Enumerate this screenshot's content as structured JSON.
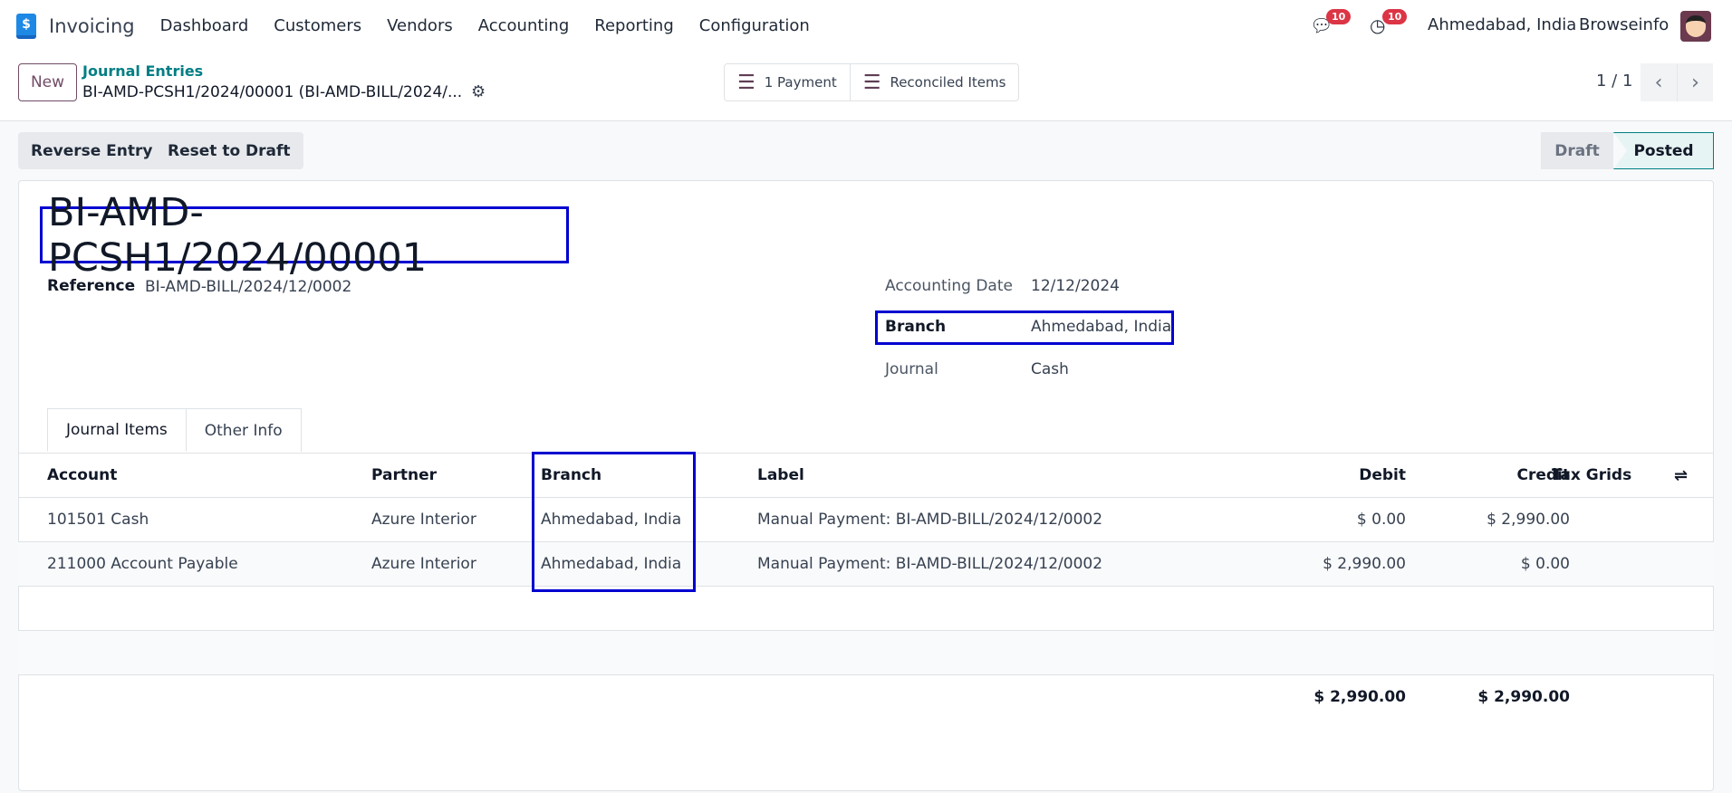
{
  "navbar": {
    "app_name": "Invoicing",
    "logo_glyph": "$",
    "menu": [
      "Dashboard",
      "Customers",
      "Vendors",
      "Accounting",
      "Reporting",
      "Configuration"
    ],
    "messages_count": "10",
    "activities_count": "10",
    "company": "Ahmedabad, India",
    "user": "Browseinfo"
  },
  "control_panel": {
    "new_label": "New",
    "breadcrumb_parent": "Journal Entries",
    "breadcrumb_current": "BI-AMD-PCSH1/2024/00001 (BI-AMD-BILL/2024/...",
    "smart_buttons": [
      "1 Payment",
      "Reconciled Items"
    ],
    "pager": "1 / 1"
  },
  "actions": {
    "reverse": "Reverse Entry",
    "reset": "Reset to Draft"
  },
  "statusbar": {
    "states": [
      "Draft",
      "Posted"
    ],
    "current": "Posted"
  },
  "form": {
    "title": "BI-AMD-PCSH1/2024/00001",
    "reference_label": "Reference",
    "reference": "BI-AMD-BILL/2024/12/0002",
    "date_label": "Accounting Date",
    "date": "12/12/2024",
    "branch_label": "Branch",
    "branch": "Ahmedabad, India",
    "journal_label": "Journal",
    "journal": "Cash"
  },
  "tabs": [
    "Journal Items",
    "Other Info"
  ],
  "table": {
    "headers": [
      "Account",
      "Partner",
      "Branch",
      "Label",
      "Debit",
      "Credit",
      "Tax Grids"
    ],
    "rows": [
      [
        "101501 Cash",
        "Azure Interior",
        "Ahmedabad, India",
        "Manual Payment: BI-AMD-BILL/2024/12/0002",
        "$ 0.00",
        "$ 2,990.00",
        ""
      ],
      [
        "211000 Account Payable",
        "Azure Interior",
        "Ahmedabad, India",
        "Manual Payment: BI-AMD-BILL/2024/12/0002",
        "$ 2,990.00",
        "$ 0.00",
        ""
      ]
    ],
    "total_debit": "$ 2,990.00",
    "total_credit": "$ 2,990.00"
  },
  "colors": {
    "brand": "#714b67",
    "teal": "#017e84",
    "highlight": "#0000d0"
  }
}
